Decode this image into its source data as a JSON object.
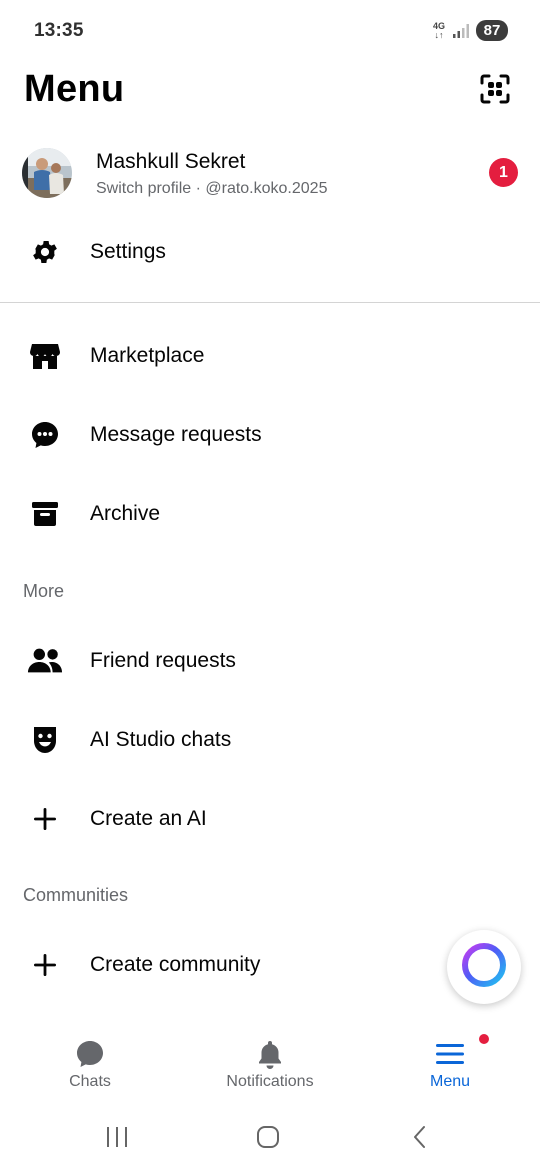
{
  "status_bar": {
    "time": "13:35",
    "network": "4G",
    "battery": "87"
  },
  "header": {
    "title": "Menu",
    "qr_icon": "qr-code-icon"
  },
  "profile": {
    "name": "Mashkull Sekret",
    "subtitle": "Switch profile · @rato.koko.2025",
    "badge": "1"
  },
  "settings": {
    "label": "Settings",
    "icon": "gear-icon"
  },
  "main_items": [
    {
      "label": "Marketplace",
      "icon": "store-icon"
    },
    {
      "label": "Message requests",
      "icon": "chat-bubble-dots-icon"
    },
    {
      "label": "Archive",
      "icon": "archive-box-icon"
    }
  ],
  "more_section": {
    "header": "More",
    "items": [
      {
        "label": "Friend requests",
        "icon": "people-icon"
      },
      {
        "label": "AI Studio chats",
        "icon": "ai-mask-icon"
      },
      {
        "label": "Create an AI",
        "icon": "plus-icon"
      }
    ]
  },
  "communities_section": {
    "header": "Communities",
    "items": [
      {
        "label": "Create community",
        "icon": "plus-icon"
      }
    ]
  },
  "bottom_nav": {
    "tabs": [
      {
        "label": "Chats",
        "icon": "chat-bubble-icon",
        "active": false
      },
      {
        "label": "Notifications",
        "icon": "bell-icon",
        "active": false
      },
      {
        "label": "Menu",
        "icon": "hamburger-menu-icon",
        "active": true
      }
    ]
  },
  "colors": {
    "accent_blue": "#0a66d8",
    "badge_red": "#e41e3f",
    "secondary_text": "#65676b"
  }
}
